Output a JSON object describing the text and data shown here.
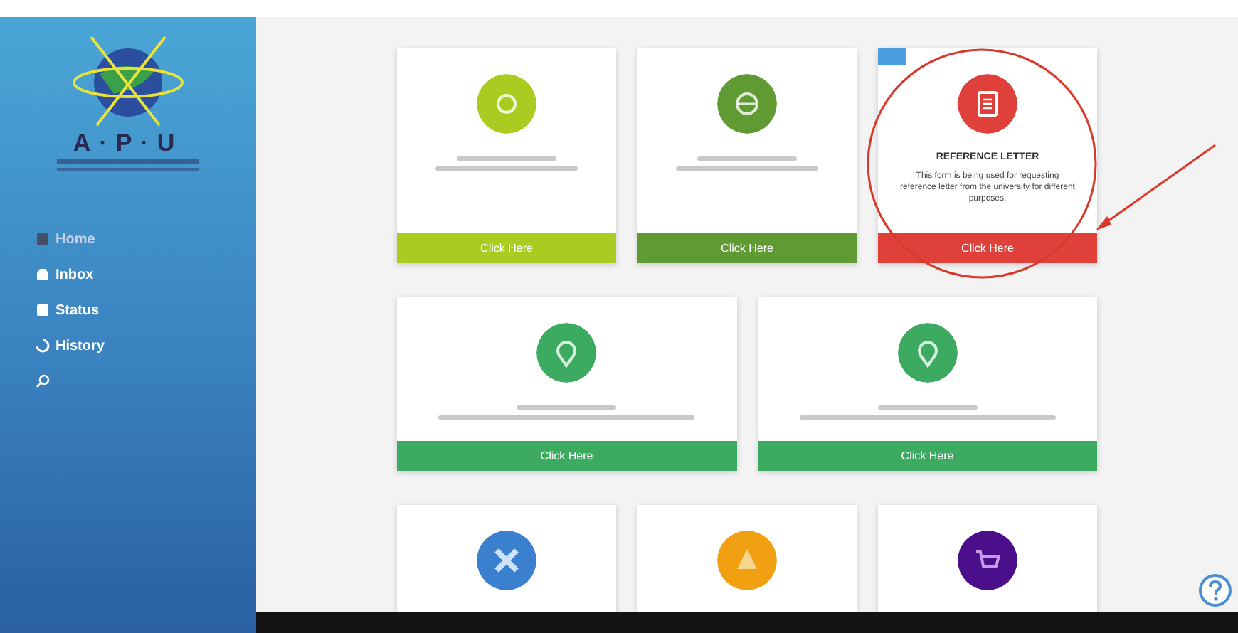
{
  "sidebar": {
    "logo_text": "A·P·U",
    "items": [
      {
        "kind": "home",
        "label": "Home"
      },
      {
        "kind": "inbox",
        "label": "Inbox"
      },
      {
        "kind": "status",
        "label": "Status"
      },
      {
        "kind": "history",
        "label": "History"
      },
      {
        "kind": "search"
      }
    ]
  },
  "card_rows": [
    [
      {
        "kind": "gear",
        "color": "#aacb1f",
        "button": "Click Here"
      },
      {
        "kind": "globe",
        "color": "#5f9a32",
        "button": "Click Here"
      },
      {
        "kind": "document",
        "color": "#e0403a",
        "badge": true,
        "title": "REFERENCE LETTER",
        "description": "This form is being used for requesting reference letter from the university for different purposes.",
        "button": "Click Here"
      }
    ],
    [
      {
        "kind": "pin",
        "color": "#3daa62",
        "button": "Click Here"
      },
      {
        "kind": "pin",
        "color": "#3daa62",
        "button": "Click Here"
      }
    ],
    [
      {
        "kind": "tools",
        "color": "#3b7fcf"
      },
      {
        "kind": "warning",
        "color": "#f0a011"
      },
      {
        "kind": "cart",
        "color": "#4b0f8c"
      }
    ]
  ]
}
